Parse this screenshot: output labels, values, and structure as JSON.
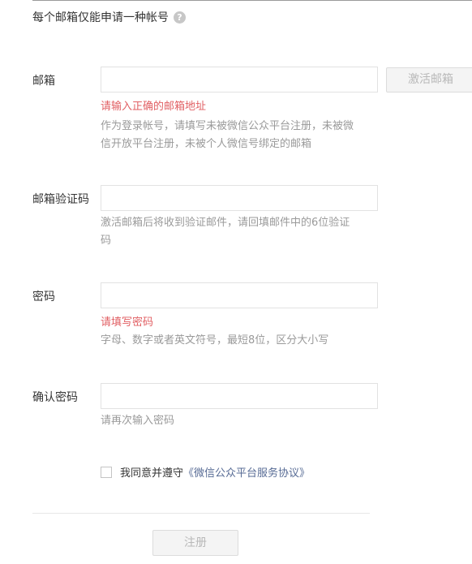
{
  "header": {
    "title": "每个邮箱仅能申请一种帐号",
    "help_glyph": "?"
  },
  "form": {
    "email": {
      "label": "邮箱",
      "value": "",
      "placeholder": "",
      "activate_button": "激活邮箱",
      "error": "请输入正确的邮箱地址",
      "tip": "作为登录帐号，请填写未被微信公众平台注册，未被微信开放平台注册，未被个人微信号绑定的邮箱"
    },
    "verify_code": {
      "label": "邮箱验证码",
      "value": "",
      "placeholder": "",
      "tip": "激活邮箱后将收到验证邮件，请回填邮件中的6位验证码"
    },
    "password": {
      "label": "密码",
      "value": "",
      "placeholder": "",
      "error": "请填写密码",
      "tip": "字母、数字或者英文符号，最短8位，区分大小写"
    },
    "confirm_password": {
      "label": "确认密码",
      "value": "",
      "placeholder": "",
      "tip": "请再次输入密码"
    }
  },
  "agreement": {
    "checked": false,
    "text": "我同意并遵守",
    "link": "《微信公众平台服务协议》"
  },
  "register_button": "注册",
  "colors": {
    "error": "#e15f63",
    "link": "#576b95",
    "tip": "#9a9a9a",
    "disabled_text": "#b8b8b8"
  }
}
